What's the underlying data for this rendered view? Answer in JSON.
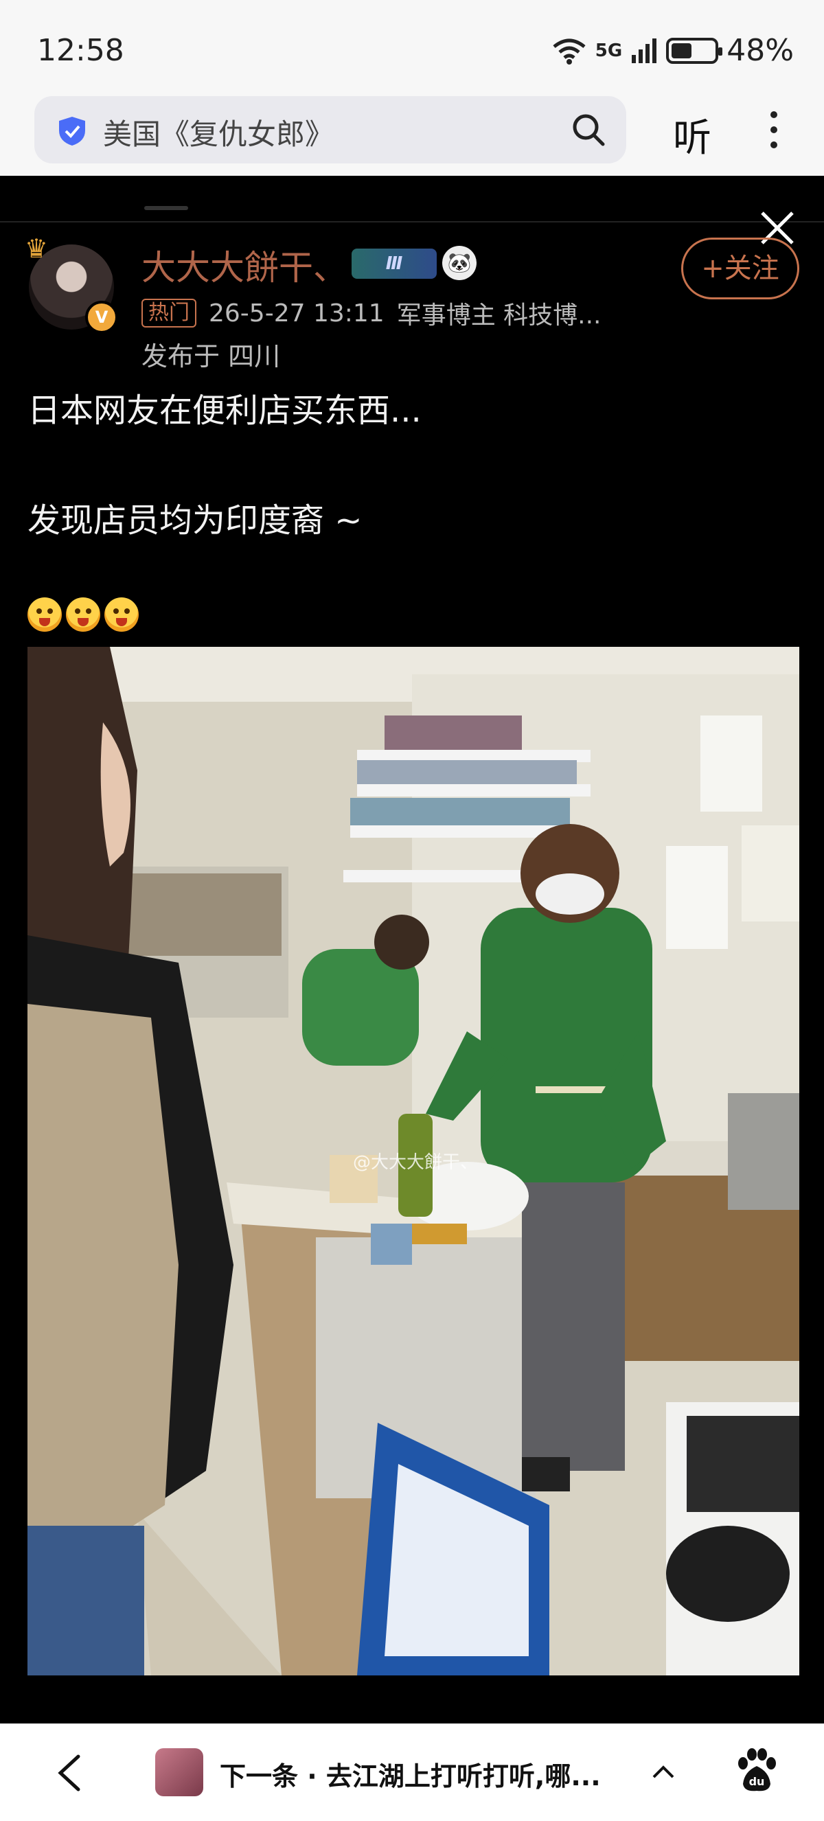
{
  "status": {
    "time": "12:58",
    "network": "5G",
    "battery": "48%",
    "battery_level": 0.48
  },
  "search": {
    "query": "美国《复仇女郎》",
    "listen_label": "听"
  },
  "post": {
    "username": "大大大餅干、",
    "level_badge": "Ⅲ",
    "follow_label": "+关注",
    "hot_tag": "热门",
    "datetime": "26-5-27 13:11",
    "tags": "军事博主 科技博...",
    "location": "发布于 四川",
    "text_line1": "日本网友在便利店买东西...",
    "text_line2": "发现店员均为印度裔 ~",
    "photo_watermark": "@大大大餅干、"
  },
  "bottom": {
    "next_label": "下一条 · 去江湖上打听打听,哪..."
  },
  "colors": {
    "accent": "#c8734e",
    "username": "#b0654a",
    "background": "#000000"
  }
}
